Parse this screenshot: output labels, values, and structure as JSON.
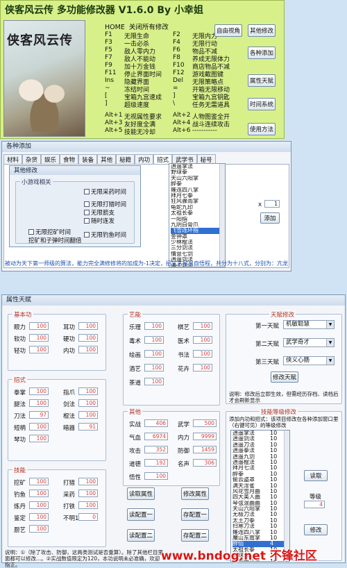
{
  "top": {
    "title": "侠客风云传 多功能修改器 V1.6.0 By 小幸姐",
    "logo": "侠客风云传",
    "home_label": "HOME  关闭所有修改",
    "hotkeys": [
      [
        "F1",
        "无限生命",
        "F2",
        "无限内力"
      ],
      [
        "F3",
        "一击必杀",
        "F4",
        "无限行动"
      ],
      [
        "F5",
        "敌人零内力",
        "F6",
        "物品不减"
      ],
      [
        "F7",
        "敌人不能动",
        "F8",
        "养成无限体力"
      ],
      [
        "F9",
        "加十万金钱",
        "F10",
        "商店物品不减"
      ],
      [
        "F11",
        "停止界面时间",
        "F12",
        "游戏截图键"
      ],
      [
        "Ins",
        "隐藏界面",
        "Del",
        "无限策略点"
      ],
      [
        "[",
        "宝箱九宫速成",
        "]",
        "宝箱九宫钥匙"
      ],
      [
        "]",
        "超级速度",
        "\\",
        "任务无需道具"
      ]
    ],
    "hotkeys_b": [
      [
        "~",
        "冻结时间",
        "=",
        "开箱无限移动"
      ]
    ],
    "alt_keys": [
      [
        "Alt+1",
        "无视属性要求",
        "Alt+2",
        "人物图鉴全开"
      ],
      [
        "Alt+3",
        "友好度全满",
        "Alt+4",
        "战斗连续攻击"
      ],
      [
        "Alt+5",
        "技能无冷却",
        "Alt+6",
        "-----------"
      ]
    ],
    "buttons_mid": [
      "自由视角",
      "其他修改"
    ],
    "buttons_right": [
      "各种添加",
      "属性天赋",
      "时间系统",
      "使用方法"
    ]
  },
  "add": {
    "title": "各种添加",
    "tabs": [
      "材料",
      "杂货",
      "娱乐",
      "食物",
      "装备",
      "其他",
      "秘籍",
      "内功",
      "招式",
      "武学书",
      "秘号"
    ],
    "inner_title": "其他修改",
    "mini_title": "小游戏相关",
    "checks": [
      "无限采药时间",
      "无限打猎时间",
      "无限箭支",
      "随时连发",
      "无限挖矿时间",
      "无限钓鱼时间"
    ],
    "mining": "挖矿和子弹时间翻倍",
    "list": [
      "逍遥掌法",
      "野球拳",
      "天山六阳掌",
      "醉拳",
      "雍连四八掌",
      "拜月七拳",
      "狂风骤雨掌",
      "龟蛇九印",
      "太祖长拳",
      "一阳指",
      "九阴白骨爪",
      "飞雪连环指",
      "金钟罩",
      "少林棍法",
      "三分剑法",
      "情意七剑",
      "逍遥剑法",
      "诸子剑法",
      "独孤九剑",
      "太子四阵剑",
      "闻字刘斗刀"
    ],
    "qty_label": "x",
    "qty": "1",
    "add_btn": "添加",
    "note": "被动为天下第一师级的算法，能力完全满修修将的加成为-1决定，招式名留出自悟程，共分为十八式，分别为：亢龙有悔、飞龙在天、龙战於野……"
  },
  "attr": {
    "title": "属性天赋",
    "basic": {
      "label": "基本功",
      "items": [
        [
          "眼力",
          "100"
        ],
        [
          "耳功",
          "100"
        ],
        [
          "软功",
          "100"
        ],
        [
          "硬功",
          "100"
        ],
        [
          "轻功",
          "100"
        ],
        [
          "内功",
          "100"
        ]
      ]
    },
    "moves": {
      "label": "招式",
      "items": [
        [
          "拳掌",
          "100"
        ],
        [
          "指爪",
          "100"
        ],
        [
          "腿法",
          "100"
        ],
        [
          "剑法",
          "100"
        ],
        [
          "刀法",
          "97"
        ],
        [
          "棍法",
          "100"
        ],
        [
          "短柄",
          "100"
        ],
        [
          "暗器",
          "91"
        ],
        [
          "琴功",
          "100"
        ]
      ]
    },
    "skills": {
      "label": "技能",
      "items": [
        [
          "挖矿",
          "100"
        ],
        [
          "打猎",
          "100"
        ],
        [
          "钓鱼",
          "100"
        ],
        [
          "采药",
          "100"
        ],
        [
          "炼丹",
          "100"
        ],
        [
          "打铁",
          "100"
        ],
        [
          "鉴定",
          "100"
        ],
        [
          "不明1",
          "0"
        ],
        [
          "厨艺",
          "100"
        ]
      ]
    },
    "arts": {
      "label": "艺能",
      "items": [
        [
          "乐理",
          "100"
        ],
        [
          "棋艺",
          "100"
        ],
        [
          "毒术",
          "100"
        ],
        [
          "医术",
          "100"
        ],
        [
          "绘画",
          "100"
        ],
        [
          "书法",
          "100"
        ],
        [
          "酒艺",
          "100"
        ],
        [
          "花卉",
          "100"
        ],
        [
          "茶道",
          "100"
        ]
      ]
    },
    "other": {
      "label": "其他",
      "items": [
        [
          "实战",
          "406"
        ],
        [
          "武学",
          "500"
        ],
        [
          "气血",
          "6974"
        ],
        [
          "内力",
          "9999"
        ],
        [
          "攻击",
          "352"
        ],
        [
          "防御",
          "1459"
        ],
        [
          "道德",
          "192"
        ],
        [
          "名声",
          "306"
        ],
        [
          "悟性",
          "100"
        ]
      ]
    },
    "buttons": [
      "读取属性",
      "修改属性",
      "读配置一",
      "存配置一",
      "读配置二",
      "存配置二"
    ],
    "talent": {
      "label": "天赋修改",
      "rows": [
        [
          "第一天赋",
          "机敏聪慧"
        ],
        [
          "第二天赋",
          "武学奇才"
        ],
        [
          "第三天赋",
          "侠义心肠"
        ]
      ],
      "btn": "修改天赋",
      "note": "说明：修改后立即生效，但需经历存档、读档后才会刷新显示"
    },
    "level": {
      "label": "技能等级修改",
      "note": "添加内功和招式：该项目修改在各种添加窗口里（右键可见）的等级修改",
      "list": [
        [
          "逍遥掌法",
          "10"
        ],
        [
          "逍遥剑法",
          "10"
        ],
        [
          "逍遥刀法",
          "10"
        ],
        [
          "逍遥拳法",
          "10"
        ],
        [
          "逍遥九剑",
          "10"
        ],
        [
          "逍遥棍法",
          "10"
        ],
        [
          "拜月七法",
          "10"
        ],
        [
          "醉拳",
          "10"
        ],
        [
          "偷云盗罩",
          "10"
        ],
        [
          "满天淫雀",
          "10"
        ],
        [
          "风花雪月曲",
          "10"
        ],
        [
          "四大美人曲",
          "10"
        ],
        [
          "琴弦混曲曲",
          "10"
        ],
        [
          "天山六阳掌",
          "10"
        ],
        [
          "无极刀法",
          "10"
        ],
        [
          "太王刀拳",
          "10"
        ],
        [
          "扫寒刀法",
          "10"
        ],
        [
          "雍连四八掌",
          "10"
        ],
        [
          "魔山东南掌",
          "10"
        ],
        [
          "醉仙",
          "4"
        ],
        [
          "太祖长拳",
          "10"
        ],
        [
          "野球拳",
          "10"
        ],
        [
          "降龙十八掌",
          "10"
        ],
        [
          "神砂罗六合",
          "10"
        ]
      ],
      "read": "读取",
      "lvl_label": "等级",
      "lvl": "4",
      "edit": "修改"
    },
    "footer": "说明：①（除了攻击、防御，这两类测试是否重算）。除了其他栏目里面都可以修改...。②实战数值限定为120，本功说明未必准确，欢迎指正。"
  },
  "watermark": "www.bndog.net 不锋社区",
  "colors": {
    "accent": "#b03020",
    "wm": "#d81818"
  }
}
